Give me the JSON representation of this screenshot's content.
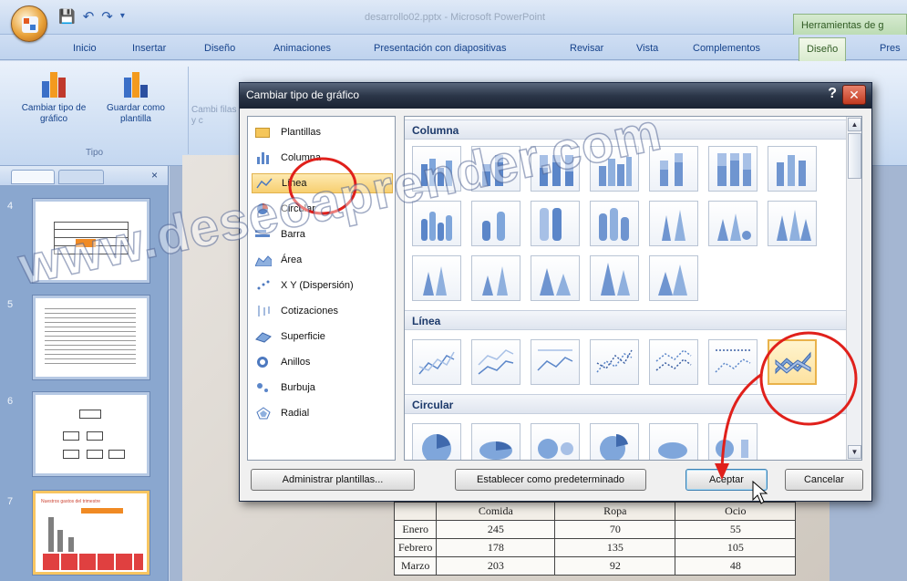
{
  "window": {
    "title": "desarrollo02.pptx - Microsoft PowerPoint",
    "context_tab_header": "Herramientas de g"
  },
  "ribbon_tabs": [
    "Inicio",
    "Insertar",
    "Diseño",
    "Animaciones",
    "Presentación con diapositivas",
    "Revisar",
    "Vista",
    "Complementos",
    "Diseño",
    "Pres"
  ],
  "ribbon": {
    "change_type_label": "Cambiar tipo de gráfico",
    "save_template_label": "Guardar como plantilla",
    "group_tipo": "Tipo",
    "truncated_label": "Cambi filas y c"
  },
  "slides": [
    {
      "number": "4"
    },
    {
      "number": "5"
    },
    {
      "number": "6"
    },
    {
      "number": "7",
      "title": "Nuestros gastos del trimestre"
    }
  ],
  "dialog": {
    "title": "Cambiar tipo de gráfico",
    "help": "?",
    "close": "✕",
    "categories": [
      "Plantillas",
      "Columna",
      "Línea",
      "Circular",
      "Barra",
      "Área",
      "X Y (Dispersión)",
      "Cotizaciones",
      "Superficie",
      "Anillos",
      "Burbuja",
      "Radial"
    ],
    "selected_category": "Línea",
    "sections": [
      "Columna",
      "Línea",
      "Circular"
    ],
    "buttons": {
      "manage": "Administrar plantillas...",
      "set_default": "Establecer como predeterminado",
      "ok": "Aceptar",
      "cancel": "Cancelar"
    }
  },
  "table": {
    "headers": [
      "",
      "Comida",
      "Ropa",
      "Ocio"
    ],
    "rows": [
      [
        "Enero",
        "245",
        "70",
        "55"
      ],
      [
        "Febrero",
        "178",
        "135",
        "105"
      ],
      [
        "Marzo",
        "203",
        "92",
        "48"
      ]
    ]
  },
  "watermark": "www.deseoaprender.com",
  "colors": {
    "annotation_red": "#e0201b",
    "selection_orange": "#f7cf70",
    "ribbon_blue": "#15428b"
  }
}
